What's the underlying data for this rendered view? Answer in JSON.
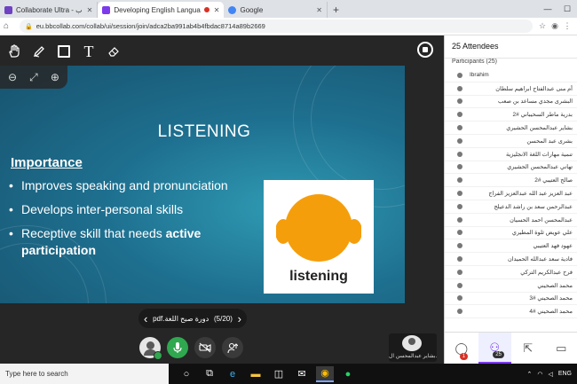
{
  "browser": {
    "tabs": [
      {
        "label": "Collaborate Ultra - ب",
        "favicon_color": "#6f42c1"
      },
      {
        "label": "Developing English Langua",
        "favicon_color": "#7c3aed",
        "active": true
      },
      {
        "label": "Google",
        "favicon_color": "#4285f4"
      }
    ],
    "url": "eu.bbcollab.com/collab/ui/session/join/adca2ba991ab4b4fbdac8714a89b2669"
  },
  "slide": {
    "title": "LISTENING",
    "heading": "Importance",
    "bullets": [
      {
        "text": "Improves speaking and pronunciation",
        "bold": ""
      },
      {
        "text": "Develops inter-personal skills",
        "bold": ""
      },
      {
        "text": "Receptive skill that needs ",
        "bold": "active participation"
      }
    ],
    "image_caption": "listening",
    "accent_color": "#f59e0b"
  },
  "pager": {
    "file": "pdf.دورة صبح اللغة",
    "page": "(5/20)"
  },
  "presenter": {
    "name": "بشاير عبدالمحسن ال..."
  },
  "attendees": {
    "title": "25 Attendees",
    "participants_label": "Participants (25)",
    "list": [
      "Ibrahim",
      "أم منى عبدالفتاح ابراهيم سلطان",
      "البشرى مجدي مساعد بن صعب",
      "بدرية ماطر السحيباني #2",
      "بشاير عبدالمحسن الحشيري",
      "بشرى عبد المحسن",
      "تنمية مهارات اللغة الانجليزية",
      "تهاني عبدالمحسن الحشيري",
      "صالح العتيبي #2",
      "عبد العزيز عبد الله عبدالعزيز الفراج",
      "عبدالرحمن سعد بن راشد الدعيلج",
      "عبدالمحسن احمد الحسيان",
      "علي عويض ثلوة المطيري",
      "عهود فهد العتيبي",
      "فادية سعد عبدالله الحميدان",
      "فرح عبدالكريم التركي",
      "محمد الصحيني",
      "محمد الصحيني #3",
      "محمد الصحيني #4"
    ],
    "chat_badge": "1",
    "people_badge": "25"
  },
  "taskbar": {
    "search_placeholder": "Type here to search",
    "lang": "ENG"
  }
}
